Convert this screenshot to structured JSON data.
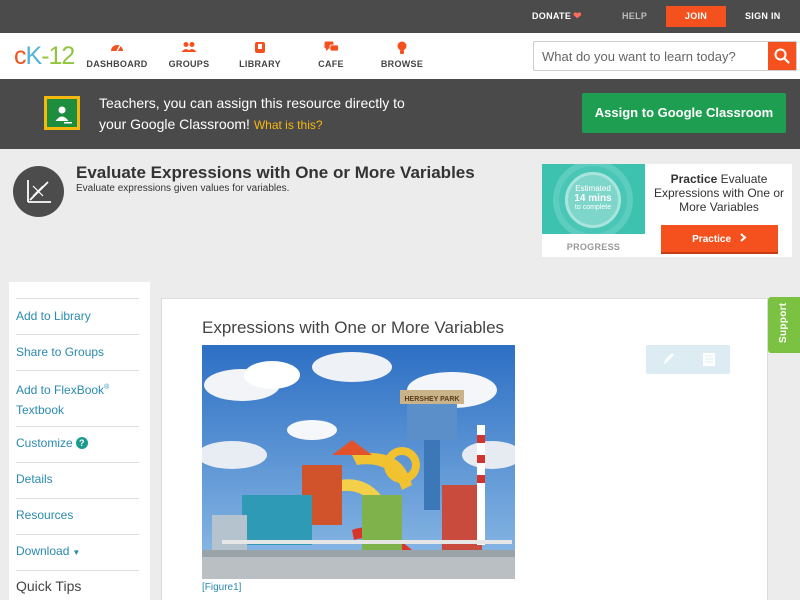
{
  "topbar": {
    "donate": "DONATE",
    "help": "HELP",
    "join": "JOIN",
    "signin": "SIGN IN"
  },
  "header": {
    "logo": {
      "c": "c",
      "k": "K",
      "dash": "-",
      "num": "12"
    },
    "nav": [
      {
        "label": "DASHBOARD",
        "icon": "dashboard-icon"
      },
      {
        "label": "GROUPS",
        "icon": "groups-icon"
      },
      {
        "label": "LIBRARY",
        "icon": "library-icon"
      },
      {
        "label": "CAFE",
        "icon": "cafe-icon"
      },
      {
        "label": "BROWSE",
        "icon": "browse-icon"
      }
    ],
    "search": {
      "placeholder": "What do you want to learn today?"
    }
  },
  "banner": {
    "line1": "Teachers, you can assign this resource directly to",
    "line2": "your Google Classroom!",
    "what": "What is this?",
    "button": "Assign to Google Classroom"
  },
  "concept": {
    "title": "Evaluate Expressions with One or More Variables",
    "subtitle": "Evaluate expressions given values for variables."
  },
  "practice": {
    "est_line1": "Estimated",
    "est_line2": "14 mins",
    "est_line3": "to complete",
    "progress": "PROGRESS",
    "label_bold": "Practice",
    "label_rest": "Evaluate Expressions with One or More Variables",
    "button": "Practice"
  },
  "sidebar": {
    "add_library": "Add to Library",
    "share_groups": "Share to Groups",
    "add_flexbook": "Add to FlexBook",
    "reg": "®",
    "textbook": "Textbook",
    "customize": "Customize",
    "help_mark": "?",
    "details": "Details",
    "resources": "Resources",
    "download": "Download",
    "caret": "▼",
    "quick_tips": "Quick Tips"
  },
  "content": {
    "title": "Expressions with One or More Variables",
    "figure_caption": "[Figure1]",
    "sign_text": "HERSHEY PARK"
  },
  "support": "Support",
  "colors": {
    "accent": "#f4511e",
    "teal": "#3ec2b0",
    "green": "#1e9e50",
    "link": "#2a8ab0",
    "support": "#7cc242"
  }
}
